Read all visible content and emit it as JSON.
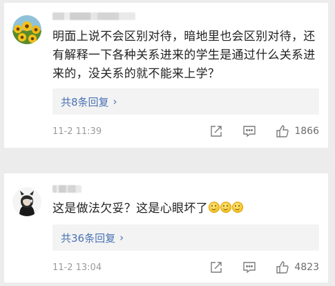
{
  "comments": [
    {
      "text": "明面上说不会区别对待，暗地里也会区别对待，还有解释一下各种关系进来的学生是通过什么关系进来的，没关系的就不能来上学？",
      "replies_label": "共8条回复",
      "timestamp": "11-2 11:39",
      "likes": "1866",
      "avatar": "sunflower-field"
    },
    {
      "text": "这是做法欠妥？这是心眼坏了",
      "replies_label": "共36条回复",
      "timestamp": "11-2 13:04",
      "likes": "4823",
      "avatar": "dark-anime-figure",
      "emoji_count": 3
    }
  ],
  "colors": {
    "link": "#4a72b3",
    "meta": "#9a9a9a",
    "text": "#222222",
    "background": "#ececec"
  },
  "icons": [
    "chevron-right-icon",
    "share-icon",
    "comment-icon",
    "thumbs-up-icon",
    "smile-emoji"
  ]
}
